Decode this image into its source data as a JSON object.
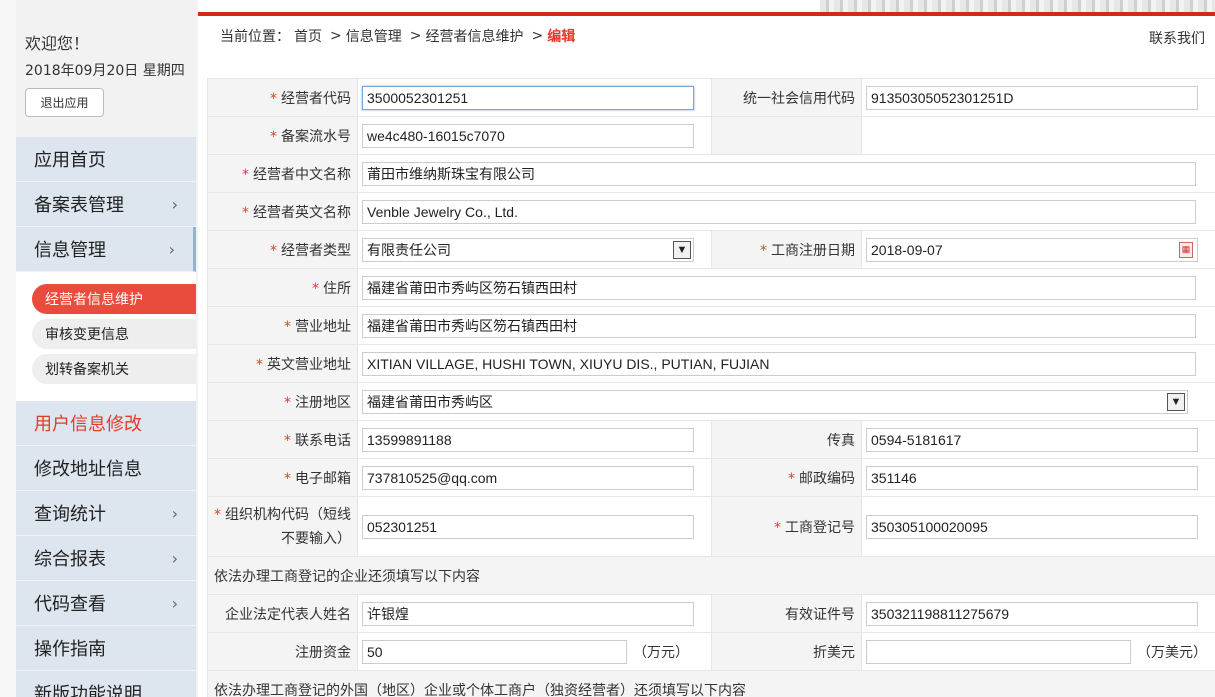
{
  "sidebar": {
    "welcome": "欢迎您！",
    "date": "2018年09月20日 星期四",
    "logout": "退出应用",
    "menu_top": [
      {
        "label": "应用首页",
        "chevron": false
      },
      {
        "label": "备案表管理",
        "chevron": true
      },
      {
        "label": "信息管理",
        "chevron": true
      }
    ],
    "submenu": [
      {
        "label": "经营者信息维护",
        "active": true
      },
      {
        "label": "审核变更信息",
        "active": false
      },
      {
        "label": "划转备案机关",
        "active": false
      }
    ],
    "menu_bottom": [
      {
        "label": "用户信息修改",
        "chevron": false,
        "red": true
      },
      {
        "label": "修改地址信息",
        "chevron": false
      },
      {
        "label": "查询统计",
        "chevron": true
      },
      {
        "label": "综合报表",
        "chevron": true
      },
      {
        "label": "代码查看",
        "chevron": true
      },
      {
        "label": "操作指南",
        "chevron": false
      },
      {
        "label": "新版功能说明",
        "chevron": false
      }
    ],
    "chevron_glyph": "›"
  },
  "breadcrumb": {
    "prefix": "当前位置：",
    "items": [
      "首页",
      "信息管理",
      "经营者信息维护"
    ],
    "separator": ">",
    "current": "编辑",
    "contact": "联系我们"
  },
  "form": {
    "star": "*",
    "operator_code": {
      "label": "经营者代码",
      "value": "3500052301251"
    },
    "credit_code": {
      "label": "统一社会信用代码",
      "value": "91350305052301251D"
    },
    "serial_no": {
      "label": "备案流水号",
      "value": "we4c480-16015c7070"
    },
    "cn_name": {
      "label": "经营者中文名称",
      "value": "莆田市维纳斯珠宝有限公司"
    },
    "en_name": {
      "label": "经营者英文名称",
      "value": "Venble Jewelry Co., Ltd."
    },
    "op_type": {
      "label": "经营者类型",
      "value": "有限责任公司"
    },
    "reg_date": {
      "label": "工商注册日期",
      "value": "2018-09-07"
    },
    "residence": {
      "label": "住所",
      "value": "福建省莆田市秀屿区笏石镇西田村"
    },
    "biz_addr": {
      "label": "营业地址",
      "value": "福建省莆田市秀屿区笏石镇西田村"
    },
    "en_biz_addr": {
      "label": "英文营业地址",
      "value": "XITIAN VILLAGE, HUSHI TOWN, XIUYU DIS., PUTIAN, FUJIAN"
    },
    "reg_area": {
      "label": "注册地区",
      "value": "福建省莆田市秀屿区"
    },
    "phone": {
      "label": "联系电话",
      "value": "13599891188"
    },
    "fax": {
      "label": "传真",
      "value": "0594-5181617"
    },
    "email": {
      "label": "电子邮箱",
      "value": "737810525@qq.com"
    },
    "postcode": {
      "label": "邮政编码",
      "value": "351146"
    },
    "org_code": {
      "label": "组织机构代码（短线不要输入）",
      "value": "052301251"
    },
    "biz_reg_no": {
      "label": "工商登记号",
      "value": "350305100020095"
    },
    "section1": "依法办理工商登记的企业还须填写以下内容",
    "legal_rep": {
      "label": "企业法定代表人姓名",
      "value": "许银煌"
    },
    "id_no": {
      "label": "有效证件号",
      "value": "350321198811275679"
    },
    "capital": {
      "label": "注册资金",
      "value": "50",
      "unit": "（万元）"
    },
    "usd": {
      "label": "折美元",
      "value": "",
      "unit": "（万美元）"
    },
    "section2": "依法办理工商登记的外国（地区）企业或个体工商户（独资经营者）还须填写以下内容"
  }
}
